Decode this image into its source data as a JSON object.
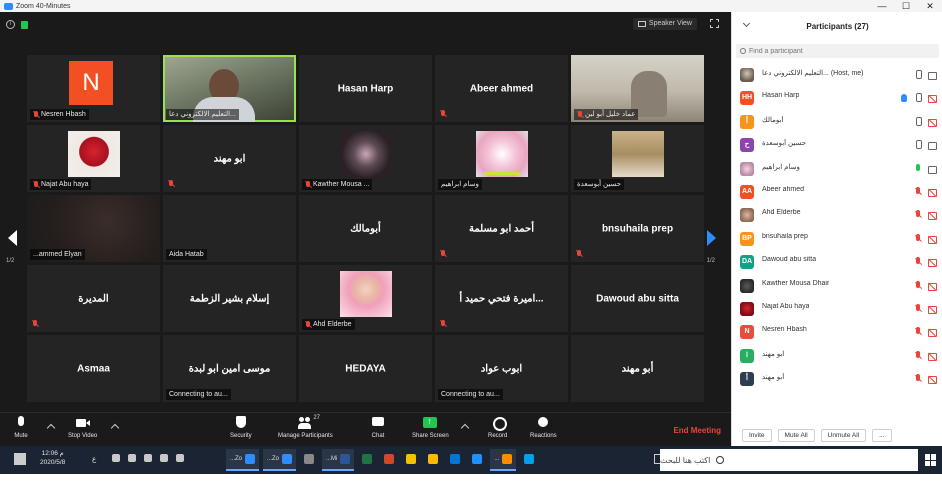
{
  "window": {
    "title": "Zoom 40-Minutes",
    "controls": [
      "—",
      "☐",
      "✕"
    ]
  },
  "meeting": {
    "speaker_view_label": "Speaker View",
    "page_indicator_left": "1/2",
    "page_indicator_right": "1/2",
    "tiles": [
      {
        "name": "Nesren Hbash",
        "kind": "avatar",
        "avatar_letter": "N",
        "muted": true
      },
      {
        "name": "التعليم الالكتروني دعا...",
        "kind": "video",
        "muted": false,
        "active": true
      },
      {
        "name": "Hasan Harp",
        "kind": "name",
        "muted": false
      },
      {
        "name": "Abeer ahmed",
        "kind": "name",
        "muted": true
      },
      {
        "name": "عماد خليل أبو لبن",
        "kind": "video-room",
        "muted": true
      },
      {
        "name": "Najat Abu haya",
        "kind": "pic-rose",
        "muted": true
      },
      {
        "name": "ابو مهند",
        "kind": "name",
        "muted": true
      },
      {
        "name": "Kawther Mousa ...",
        "kind": "pic-dark-flower",
        "muted": true
      },
      {
        "name": "وسام ابراهيم",
        "kind": "pic-pink",
        "muted": false
      },
      {
        "name": "حسين أبوسعدة",
        "kind": "pic-shelf",
        "muted": false
      },
      {
        "name": "...ammed Elyan",
        "kind": "dim-video",
        "muted": false
      },
      {
        "name": "Aida Hatab",
        "kind": "label-only",
        "muted": false
      },
      {
        "name": "أبومالك",
        "kind": "name",
        "muted": false
      },
      {
        "name": "أحمد ابو مسلمة",
        "kind": "name",
        "muted": true
      },
      {
        "name": "bnsuhaila prep",
        "kind": "name",
        "muted": true
      },
      {
        "name": "المديرة",
        "kind": "name",
        "muted": true
      },
      {
        "name": "إسلام بشير الزطمة",
        "kind": "name",
        "muted": false
      },
      {
        "name": "Ahd Elderbe",
        "kind": "pic-girl",
        "muted": true
      },
      {
        "name": "اميرة فتحي حميد أ...",
        "kind": "name",
        "muted": true
      },
      {
        "name": "Dawoud abu sitta",
        "kind": "name",
        "muted": false
      },
      {
        "name": "Asmaa",
        "kind": "name",
        "muted": false
      },
      {
        "name": "موسى امين ابو لبدة",
        "kind": "name",
        "sub": "Connecting to au...",
        "muted": false
      },
      {
        "name": "HEDAYA",
        "kind": "name",
        "muted": false
      },
      {
        "name": "ابوب عواد",
        "kind": "name",
        "sub": "Connecting to au...",
        "muted": false
      },
      {
        "name": "أبو مهند",
        "kind": "name",
        "muted": false
      }
    ]
  },
  "toolbar": {
    "mute": "Mute",
    "stop_video": "Stop Video",
    "security": "Security",
    "manage_participants": "Manage Participants",
    "participant_count": "27",
    "chat": "Chat",
    "share_screen": "Share Screen",
    "record": "Record",
    "reactions": "Reactions",
    "end_meeting": "End Meeting"
  },
  "participants_panel": {
    "title": "Participants (27)",
    "search_placeholder": "Find a participant",
    "rows": [
      {
        "name": "التعليم الالكتروني دعا...  (Host, me)",
        "avatar": "photo",
        "letter": "",
        "color": "",
        "mic": "mic-on",
        "cam": "cam-on",
        "hand": false
      },
      {
        "name": "Hasan Harp",
        "avatar": "letter",
        "letter": "HH",
        "color": "#f25022",
        "mic": "mic-on",
        "cam": "cam-off",
        "hand": true
      },
      {
        "name": "أبومالك",
        "avatar": "letter",
        "letter": "أ",
        "color": "#f7941d",
        "mic": "mic-on",
        "cam": "cam-off",
        "hand": false
      },
      {
        "name": "حسين أبوسعدة",
        "avatar": "letter",
        "letter": "ح",
        "color": "#8e44ad",
        "mic": "mic-on",
        "cam": "cam-on",
        "hand": false
      },
      {
        "name": "وسام ابراهيم",
        "avatar": "flower",
        "letter": "",
        "color": "",
        "mic": "mic-green",
        "cam": "cam-on",
        "hand": false
      },
      {
        "name": "Abeer ahmed",
        "avatar": "letter",
        "letter": "AA",
        "color": "#f25022",
        "mic": "mic-off",
        "cam": "cam-off",
        "hand": false
      },
      {
        "name": "Ahd Elderbe",
        "avatar": "kids",
        "letter": "",
        "color": "",
        "mic": "mic-off",
        "cam": "cam-off",
        "hand": false
      },
      {
        "name": "bnsuhaila prep",
        "avatar": "letter",
        "letter": "BP",
        "color": "#f7941d",
        "mic": "mic-off",
        "cam": "cam-off",
        "hand": false
      },
      {
        "name": "Dawoud abu sitta",
        "avatar": "letter",
        "letter": "DA",
        "color": "#16a085",
        "mic": "mic-off",
        "cam": "cam-off",
        "hand": false
      },
      {
        "name": "Kawther Mousa Dhair",
        "avatar": "dark",
        "letter": "",
        "color": "",
        "mic": "mic-off",
        "cam": "cam-off",
        "hand": false
      },
      {
        "name": "Najat Abu haya",
        "avatar": "rose",
        "letter": "",
        "color": "",
        "mic": "mic-off",
        "cam": "cam-off",
        "hand": false
      },
      {
        "name": "Nesren Hbash",
        "avatar": "letter",
        "letter": "N",
        "color": "#e74c3c",
        "mic": "mic-off",
        "cam": "cam-off",
        "hand": false
      },
      {
        "name": "ابو مهند",
        "avatar": "letter",
        "letter": "ا",
        "color": "#27ae60",
        "mic": "mic-off",
        "cam": "cam-off",
        "hand": false
      },
      {
        "name": "أبو مهند",
        "avatar": "letter",
        "letter": "أ",
        "color": "#2c3e50",
        "mic": "mic-off",
        "cam": "cam-off",
        "hand": false
      }
    ],
    "invite": "Invite",
    "mute_all": "Mute All",
    "unmute_all": "Unmute All",
    "more": "..."
  },
  "taskbar": {
    "search_placeholder": "اكتب هنا للبحث",
    "time": "12:06 م",
    "date": "2020/5/8",
    "lang": "ع",
    "apps": [
      {
        "label": "...Zo",
        "color": "#2d8cff",
        "active": true
      },
      {
        "label": "...Zo",
        "color": "#2d8cff",
        "active": true
      },
      {
        "label": "",
        "color": "#888888",
        "active": false
      },
      {
        "label": "...Mi",
        "color": "#2b579a",
        "active": true
      },
      {
        "label": "",
        "color": "#217346",
        "active": false
      },
      {
        "label": "",
        "color": "#d24726",
        "active": false
      },
      {
        "label": "",
        "color": "#f3c300",
        "active": false
      },
      {
        "label": "",
        "color": "#ffb900",
        "active": false
      },
      {
        "label": "",
        "color": "#0078d7",
        "active": false
      },
      {
        "label": "",
        "color": "#1e90ff",
        "active": false
      },
      {
        "label": "...",
        "color": "#ff8c00",
        "active": true
      },
      {
        "label": "",
        "color": "#00a2ed",
        "active": false
      }
    ]
  }
}
